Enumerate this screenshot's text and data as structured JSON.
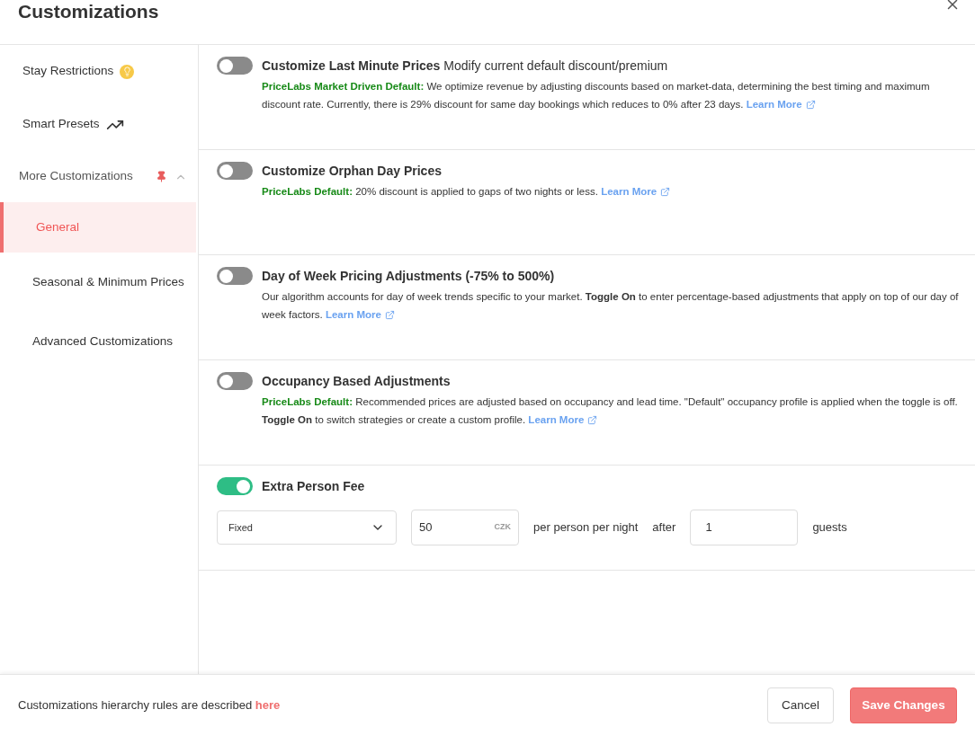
{
  "dialog": {
    "title": "Customizations"
  },
  "sidebar": {
    "items": [
      {
        "label": "Stay Restrictions",
        "kind": "hint",
        "selected": false
      },
      {
        "label": "Smart Presets",
        "kind": "trend",
        "selected": false
      },
      {
        "label": "More Customizations",
        "kind": "group",
        "pinned": true,
        "expanded": true,
        "children": [
          {
            "label": "General",
            "selected": true
          },
          {
            "label": "Seasonal & Minimum Prices",
            "selected": false
          },
          {
            "label": "Advanced Customizations",
            "selected": false
          }
        ]
      }
    ]
  },
  "sections": [
    {
      "title": "Customize Last Minute Prices",
      "subtitle": "Modify current default discount/premium",
      "on": false,
      "default_label": "PriceLabs Market Driven Default:",
      "description": "We optimize revenue by adjusting discounts based on market-data, determining the best timing and maximum discount rate. Currently, there is 29% discount for same day bookings which reduces to 0% after 23 days.",
      "link": "Learn More"
    },
    {
      "title": "Customize Orphan Day Prices",
      "on": false,
      "default_label": "PriceLabs Default:",
      "description": "20% discount is applied to gaps of two nights or less.",
      "link": "Learn More"
    },
    {
      "title": "Day of Week Pricing Adjustments (-75% to 500%)",
      "on": false,
      "description": "Our algorithm accounts for day of week trends specific to your market. **Toggle On** to enter percentage-based adjustments that apply on top of our day of week factors.",
      "link": "Learn More"
    },
    {
      "title": "Occupancy Based Adjustments",
      "on": false,
      "default_label": "PriceLabs Default:",
      "description": "Recommended prices are adjusted based on occupancy and lead time. \"Default\" occupancy profile is applied when the toggle is off. **Toggle On** to switch strategies or create a custom profile.",
      "link": "Learn More"
    },
    {
      "title": "Extra Person Fee",
      "on": true,
      "fee": {
        "type": "Fixed",
        "amount": "50",
        "currency": "CZK",
        "per_label": "per person per night",
        "after_label": "after",
        "guests": "1",
        "guests_label": "guests"
      }
    }
  ],
  "footer": {
    "note": "Customizations hierarchy rules are described",
    "note_link": "here",
    "buttons": [
      {
        "label": "Cancel",
        "kind": "secondary"
      },
      {
        "label": "Save Changes",
        "kind": "primary"
      }
    ]
  }
}
